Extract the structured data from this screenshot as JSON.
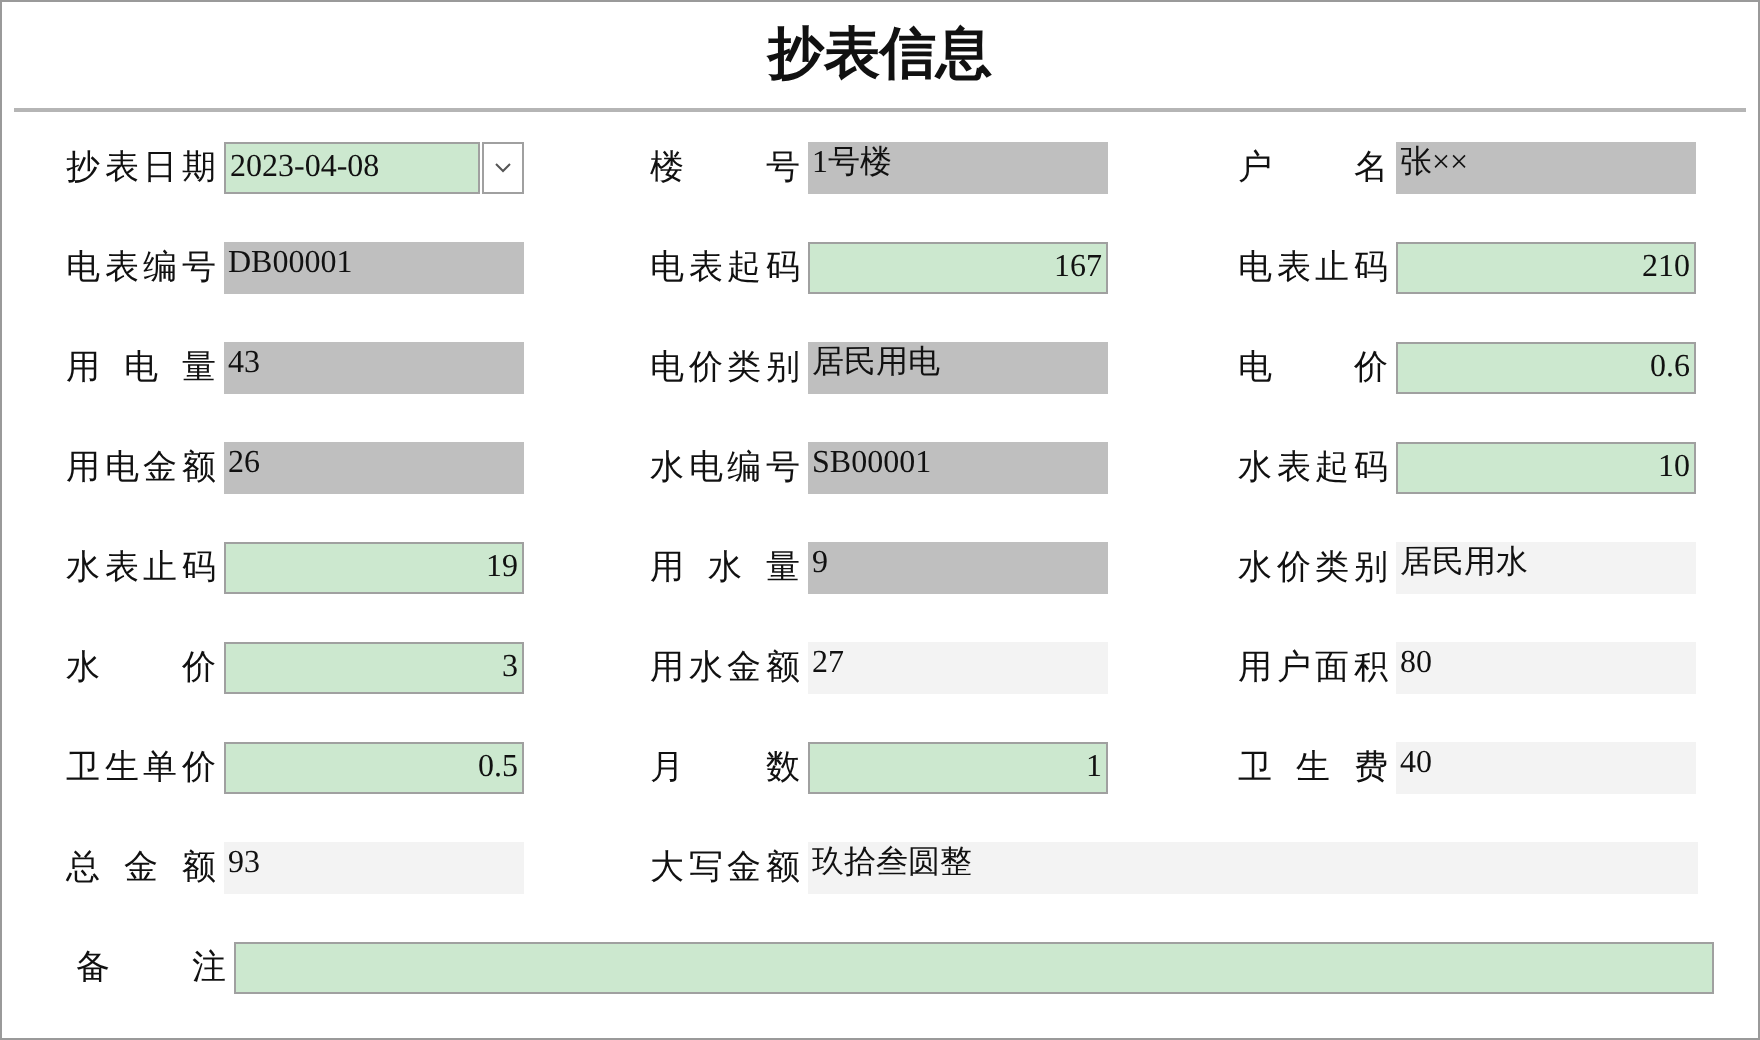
{
  "title": "抄表信息",
  "rows": [
    [
      {
        "label": "抄表日期",
        "value": "2023-04-08",
        "kind": "date",
        "wide": false
      },
      {
        "label": "楼 号",
        "value": "1号楼",
        "kind": "locked",
        "wide": false
      },
      {
        "label": "户 名",
        "value": "张××",
        "kind": "locked",
        "wide": false
      }
    ],
    [
      {
        "label": "电表编号",
        "value": "DB00001",
        "kind": "locked",
        "wide": false
      },
      {
        "label": "电表起码",
        "value": "167",
        "kind": "input",
        "wide": false
      },
      {
        "label": "电表止码",
        "value": "210",
        "kind": "input",
        "wide": false
      }
    ],
    [
      {
        "label": "用 电 量",
        "value": "43",
        "kind": "locked",
        "wide": false
      },
      {
        "label": "电价类别",
        "value": "居民用电",
        "kind": "locked",
        "wide": false
      },
      {
        "label": "电 价",
        "value": "0.6",
        "kind": "input",
        "wide": false
      }
    ],
    [
      {
        "label": "用电金额",
        "value": "26",
        "kind": "locked",
        "wide": false
      },
      {
        "label": "水电编号",
        "value": "SB00001",
        "kind": "locked",
        "wide": false
      },
      {
        "label": "水表起码",
        "value": "10",
        "kind": "input",
        "wide": false
      }
    ],
    [
      {
        "label": "水表止码",
        "value": "19",
        "kind": "input",
        "wide": false
      },
      {
        "label": "用 水 量",
        "value": "9",
        "kind": "locked",
        "wide": false
      },
      {
        "label": "水价类别",
        "value": "居民用水",
        "kind": "calc",
        "wide": false
      }
    ],
    [
      {
        "label": "水 价",
        "value": "3",
        "kind": "input",
        "wide": false
      },
      {
        "label": "用水金额",
        "value": "27",
        "kind": "calc",
        "wide": false
      },
      {
        "label": "用户面积",
        "value": "80",
        "kind": "calc",
        "wide": false
      }
    ],
    [
      {
        "label": "卫生单价",
        "value": "0.5",
        "kind": "input",
        "wide": false
      },
      {
        "label": "月 数",
        "value": "1",
        "kind": "input",
        "wide": false
      },
      {
        "label": "卫 生 费",
        "value": "40",
        "kind": "calc",
        "wide": false
      }
    ],
    [
      {
        "label": "总 金 额",
        "value": "93",
        "kind": "calc",
        "wide": false
      },
      {
        "label": "大写金额",
        "value": "玖拾叁圆整",
        "kind": "calc",
        "wide": true
      }
    ]
  ],
  "remark": {
    "label": "备 注",
    "kind": "input"
  }
}
